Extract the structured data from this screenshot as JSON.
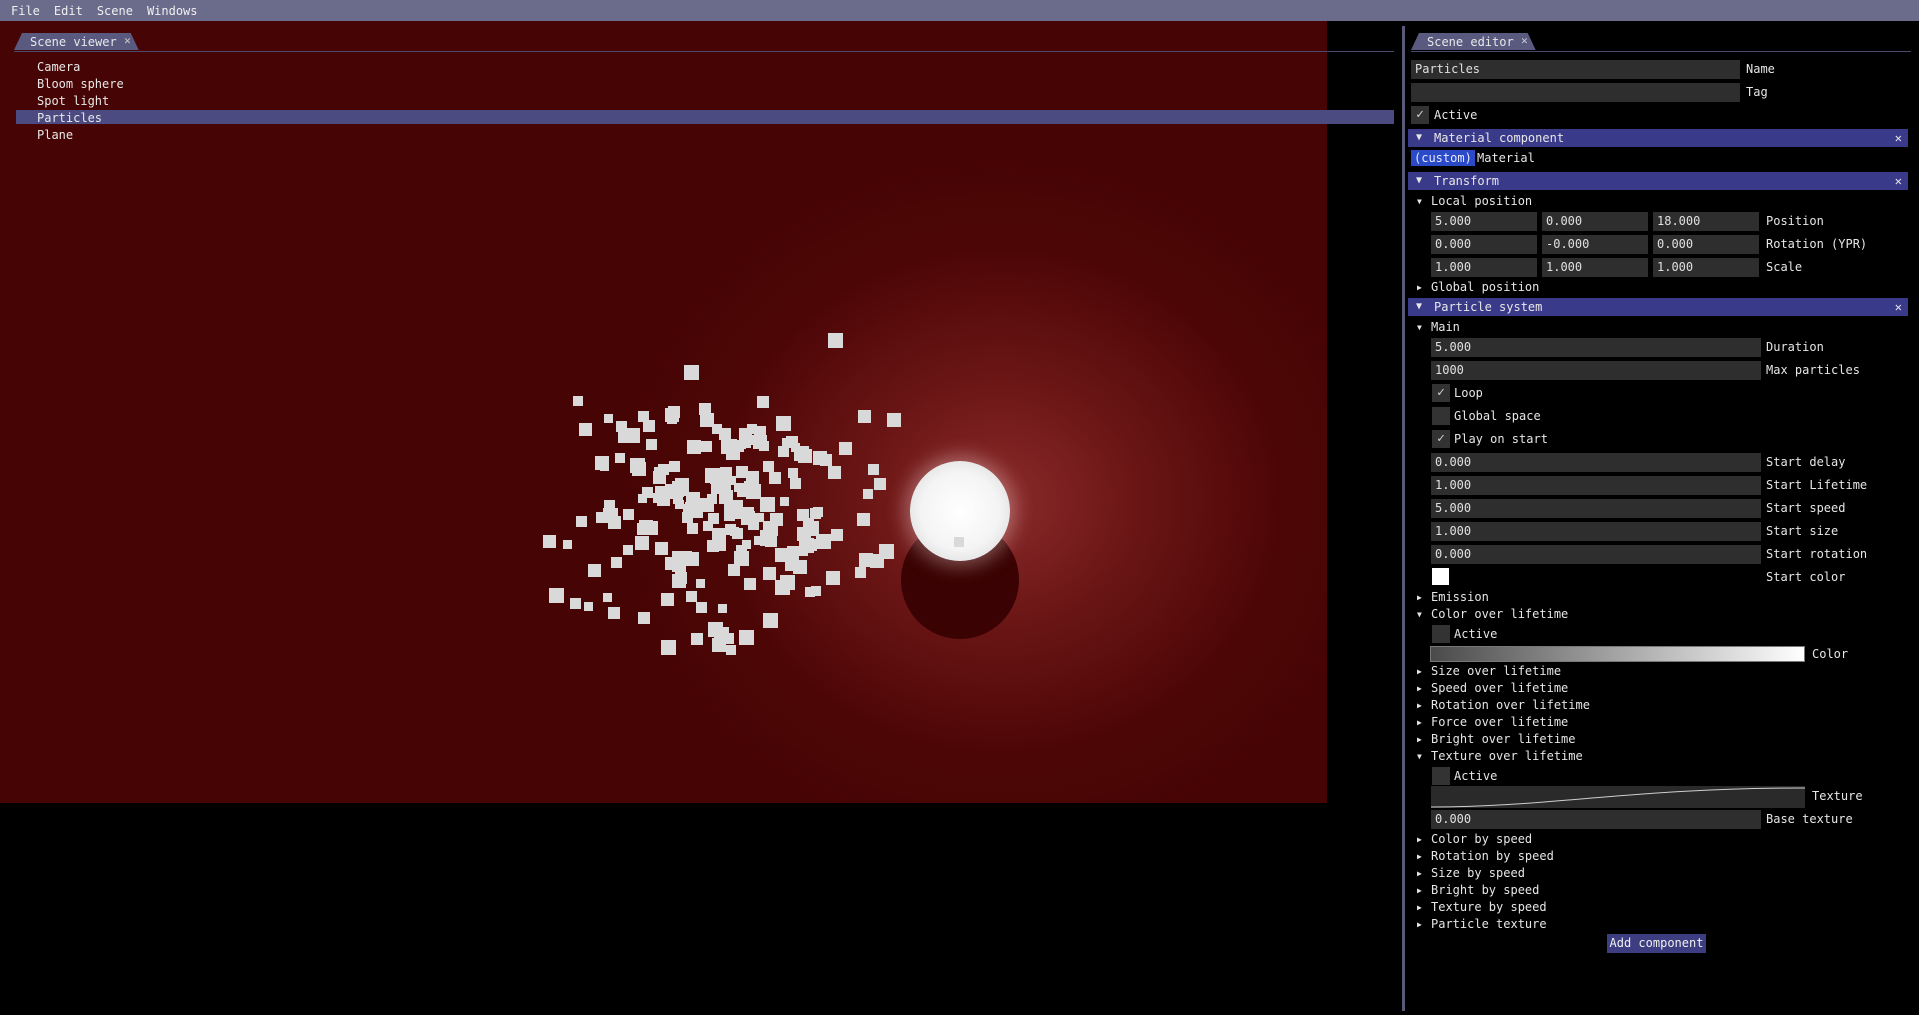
{
  "menu": [
    "File",
    "Edit",
    "Scene",
    "Windows"
  ],
  "scene_viewer": {
    "tab_label": "Scene viewer",
    "close_glyph": "✕",
    "items": [
      "Camera",
      "Bloom sphere",
      "Spot light",
      "Particles",
      "Plane"
    ],
    "selected": "Particles"
  },
  "scene_editor": {
    "tab_label": "Scene editor",
    "close_glyph": "✕",
    "name_value": "Particles",
    "name_label": "Name",
    "tag_value": "",
    "tag_label": "Tag",
    "active_label": "Active",
    "active_checked": true,
    "material_component": {
      "header": "Material component",
      "badge": "(custom)",
      "label": "Material"
    },
    "transform": {
      "header": "Transform",
      "local_position": "Local position",
      "global_position": "Global position",
      "rows": [
        {
          "label": "Position",
          "values": [
            "5.000",
            "0.000",
            "18.000"
          ]
        },
        {
          "label": "Rotation (YPR)",
          "values": [
            "0.000",
            "-0.000",
            "0.000"
          ]
        },
        {
          "label": "Scale",
          "values": [
            "1.000",
            "1.000",
            "1.000"
          ]
        }
      ]
    },
    "particle_system": {
      "header": "Particle system",
      "main": "Main",
      "duration": {
        "value": "5.000",
        "label": "Duration"
      },
      "max_particles": {
        "value": "1000",
        "label": "Max particles"
      },
      "loop": {
        "label": "Loop",
        "checked": true
      },
      "global_space": {
        "label": "Global space",
        "checked": false
      },
      "play_on_start": {
        "label": "Play on start",
        "checked": true
      },
      "start_delay": {
        "value": "0.000",
        "label": "Start delay"
      },
      "start_lifetime": {
        "value": "1.000",
        "label": "Start Lifetime"
      },
      "start_speed": {
        "value": "5.000",
        "label": "Start speed"
      },
      "start_size": {
        "value": "1.000",
        "label": "Start size"
      },
      "start_rotation": {
        "value": "0.000",
        "label": "Start rotation"
      },
      "start_color": {
        "label": "Start color",
        "color": "#ffffff"
      },
      "emission": "Emission",
      "color_over_lifetime": {
        "label": "Color over lifetime",
        "active_label": "Active",
        "color_label": "Color"
      },
      "collapsed_1": [
        "Size over lifetime",
        "Speed over lifetime",
        "Rotation over lifetime",
        "Force over lifetime",
        "Bright over lifetime"
      ],
      "texture_over_lifetime": {
        "label": "Texture over lifetime",
        "active_label": "Active",
        "texture_label": "Texture",
        "base_texture_value": "0.000",
        "base_texture_label": "Base texture"
      },
      "collapsed_2": [
        "Color by speed",
        "Rotation by speed",
        "Size by speed",
        "Bright by speed",
        "Texture by speed",
        "Particle texture"
      ]
    },
    "add_component": "Add component"
  },
  "colors": {
    "menubar": "#6b6b8c",
    "header": "#3a3a8a",
    "selection": "#4b4b82",
    "viewport_bg": "#460404",
    "badge": "#2a4ac8"
  }
}
